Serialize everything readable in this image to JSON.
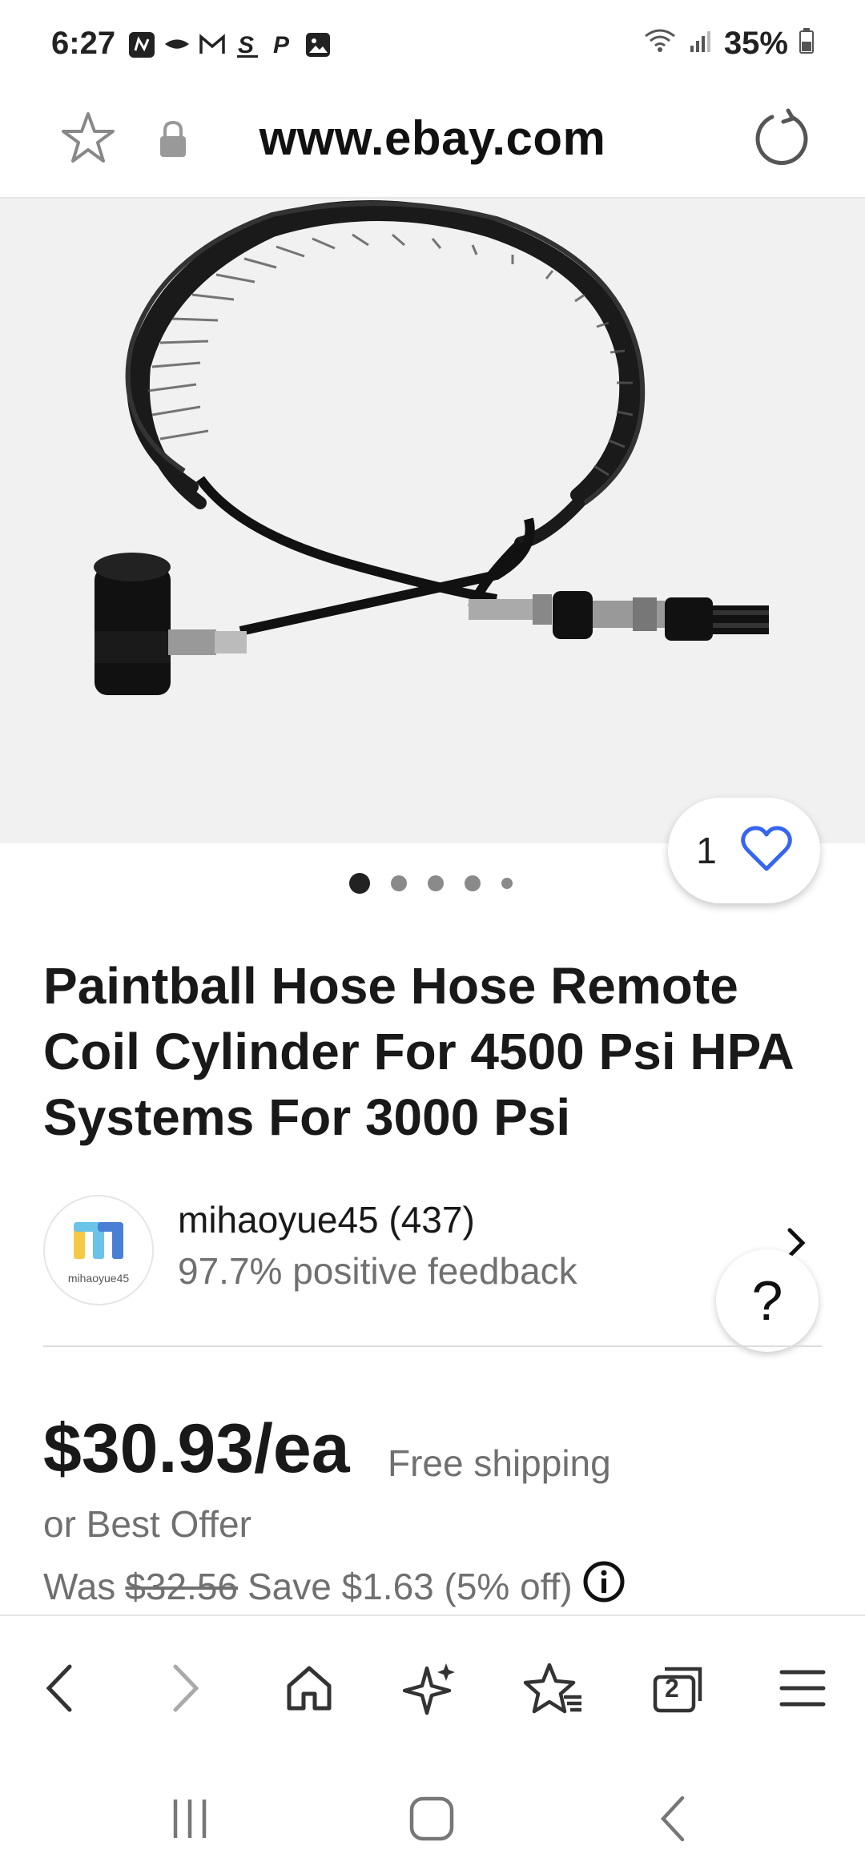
{
  "status_bar": {
    "time": "6:27",
    "battery": "35%",
    "notification_icons": [
      "n-icon",
      "cap-icon",
      "gmail-icon",
      "s-icon",
      "paypal-icon",
      "gallery-icon"
    ]
  },
  "browser": {
    "url": "www.ebay.com",
    "tabs_count": "2"
  },
  "listing": {
    "image_carousel": {
      "total": 5,
      "active": 1
    },
    "watch_count": "1",
    "title": "Paintball Hose Hose Remote Coil Cylinder For 4500 Psi HPA Systems For 3000 Psi",
    "seller": {
      "avatar_text": "mihaoyue45",
      "name": "mihaoyue45 (437)",
      "feedback": "97.7% positive feedback"
    },
    "help_label": "?",
    "price": "$30.93/ea",
    "shipping": "Free shipping",
    "offer": "or Best Offer",
    "was_label": "Was",
    "was_price": "$32.56",
    "savings": "Save $1.63 (5% off)"
  },
  "colors": {
    "accent_blue": "#3665f3",
    "text_primary": "#191919",
    "text_secondary": "#707070"
  }
}
